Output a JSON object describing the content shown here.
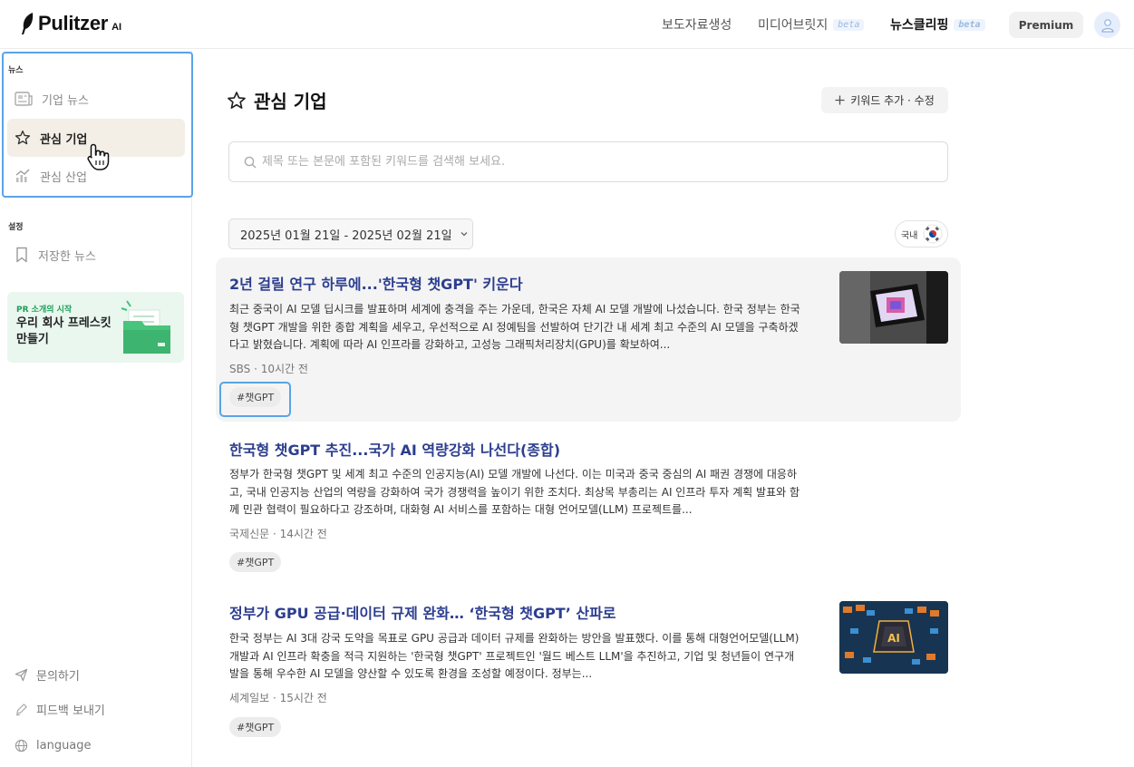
{
  "app": {
    "logo_text": "Pulitzer",
    "logo_suffix": "AI"
  },
  "topnav": {
    "press": "보도자료생성",
    "bridge": "미디어브릿지",
    "clipping": "뉴스클리핑",
    "beta": "beta",
    "premium": "Premium"
  },
  "sidebar": {
    "news_label": "뉴스",
    "settings_label": "설정",
    "items": [
      {
        "label": "기업 뉴스",
        "icon": "newspaper-icon",
        "active": false
      },
      {
        "label": "관심 기업",
        "icon": "star-icon",
        "active": true
      },
      {
        "label": "관심 산업",
        "icon": "chart-icon",
        "active": false
      }
    ],
    "saved_news": "저장한 뉴스",
    "promo": {
      "small": "PR 소개의 시작",
      "title": "우리 회사 프레스킷 만들기"
    },
    "bottom": [
      {
        "label": "문의하기",
        "icon": "send-icon"
      },
      {
        "label": "피드백 보내기",
        "icon": "pen-icon"
      },
      {
        "label": "language",
        "icon": "globe-icon"
      }
    ]
  },
  "main": {
    "title": "관심 기업",
    "keyword_button": "키워드 추가 · 수정",
    "search_placeholder": "제목 또는 본문에 포함된 키워드를 검색해 보세요.",
    "date_range": "2025년 01월 21일 - 2025년 02월 21일",
    "region": "국내",
    "articles": [
      {
        "title": "2년 걸릴 연구 하루에...'한국형 챗GPT' 키운다",
        "body": "최근 중국이 AI 모델 딥시크를 발표하며 세계에 충격을 주는 가운데, 한국은 자체 AI 모델 개발에 나섰습니다. 한국 정부는 한국형 챗GPT 개발을 위한 종합 계획을 세우고, 우선적으로 AI 정예팀을 선발하여 단기간 내 세계 최고 수준의 AI 모델을 구축하겠다고 밝혔습니다. 계획에 따라 AI 인프라를 강화하고, 고성능 그래픽처리장치(GPU)를 확보하여...",
        "meta": "SBS · 10시간 전",
        "tag": "#챗GPT"
      },
      {
        "title": "한국형 챗GPT 추진...국가 AI 역량강화 나선다(종합)",
        "body": "정부가 한국형 챗GPT 및 세계 최고 수준의 인공지능(AI) 모델 개발에 나선다. 이는 미국과 중국 중심의 AI 패권 경쟁에 대응하고, 국내 인공지능 산업의 역량을 강화하여 국가 경쟁력을 높이기 위한 조치다. 최상목 부총리는 AI 인프라 투자 계획 발표와 함께 민관 협력이 필요하다고 강조하며, 대화형 AI 서비스를 포함하는 대형 언어모델(LLM) 프로젝트를...",
        "meta": "국제신문 · 14시간 전",
        "tag": "#챗GPT"
      },
      {
        "title": "정부가 GPU 공급·데이터 규제 완화… ‘한국형 챗GPT’ 산파로",
        "body": "한국 정부는 AI 3대 강국 도약을 목표로 GPU 공급과 데이터 규제를 완화하는 방안을 발표했다. 이를 통해 대형언어모델(LLM) 개발과 AI 인프라 확충을 적극 지원하는 '한국형 챗GPT' 프로젝트인 '월드 베스트 LLM'을 추진하고, 기업 및 청년들이 연구개발을 통해 우수한 AI 모델을 양산할 수 있도록 환경을 조성할 예정이다. 정부는...",
        "meta": "세계일보 · 15시간 전",
        "tag": "#챗GPT"
      }
    ]
  },
  "colors": {
    "accent": "#59a4e6",
    "title_blue": "#2c3e8f",
    "active_bg": "#f3efe6",
    "promo_bg": "#e9f7ef"
  }
}
